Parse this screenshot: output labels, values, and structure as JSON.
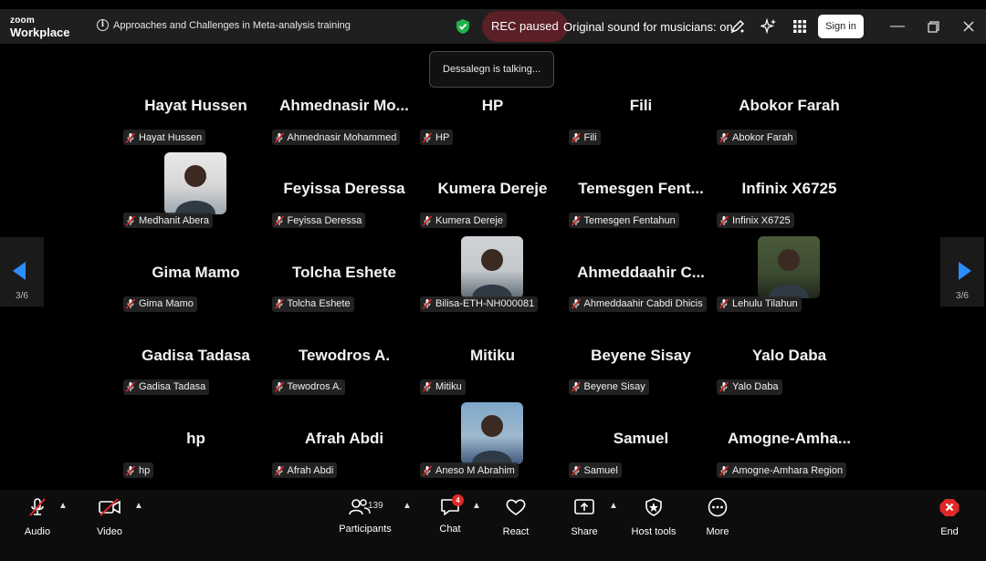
{
  "app": {
    "brand_top": "zoom",
    "brand_bottom": "Workplace"
  },
  "meeting": {
    "title": "Approaches and Challenges in Meta-analysis training"
  },
  "status": {
    "rec": "REC paused",
    "original_sound": "Original sound for musicians: on",
    "sign_in": "Sign in",
    "talking": "Dessalegn is talking..."
  },
  "nav": {
    "left_page": "3/6",
    "right_page": "3/6"
  },
  "participants": [
    {
      "big": "Hayat Hussen",
      "label": "Hayat Hussen",
      "photo": false
    },
    {
      "big": "Ahmednasir  Mo...",
      "label": "Ahmednasir Mohammed",
      "photo": false
    },
    {
      "big": "HP",
      "label": "HP",
      "photo": false
    },
    {
      "big": "Fili",
      "label": "Fili",
      "photo": false
    },
    {
      "big": "Abokor Farah",
      "label": "Abokor Farah",
      "photo": false
    },
    {
      "big": "",
      "label": "Medhanit Abera",
      "photo": true
    },
    {
      "big": "Feyissa Deressa",
      "label": "Feyissa Deressa",
      "photo": false
    },
    {
      "big": "Kumera Dereje",
      "label": "Kumera Dereje",
      "photo": false
    },
    {
      "big": "Temesgen  Fent...",
      "label": "Temesgen Fentahun",
      "photo": false
    },
    {
      "big": "Infinix X6725",
      "label": "Infinix X6725",
      "photo": false
    },
    {
      "big": "Gima Mamo",
      "label": "Gima Mamo",
      "photo": false
    },
    {
      "big": "Tolcha Eshete",
      "label": "Tolcha Eshete",
      "photo": false
    },
    {
      "big": "",
      "label": "Bilisa-ETH-NH000081",
      "photo": true
    },
    {
      "big": "Ahmeddaahir  C...",
      "label": "Ahmeddaahir Cabdi Dhicis",
      "photo": false
    },
    {
      "big": "",
      "label": "Lehulu Tilahun",
      "photo": true
    },
    {
      "big": "Gadisa Tadasa",
      "label": "Gadisa Tadasa",
      "photo": false
    },
    {
      "big": "Tewodros A.",
      "label": "Tewodros A.",
      "photo": false
    },
    {
      "big": "Mitiku",
      "label": "Mitiku",
      "photo": false
    },
    {
      "big": "Beyene Sisay",
      "label": "Beyene Sisay",
      "photo": false
    },
    {
      "big": "Yalo Daba",
      "label": "Yalo Daba",
      "photo": false
    },
    {
      "big": "hp",
      "label": "hp",
      "photo": false
    },
    {
      "big": "Afrah Abdi",
      "label": "Afrah Abdi",
      "photo": false
    },
    {
      "big": "",
      "label": "Aneso M Abrahim",
      "photo": true
    },
    {
      "big": "Samuel",
      "label": "Samuel",
      "photo": false
    },
    {
      "big": "Amogne-Amha...",
      "label": "Amogne-Amhara Region",
      "photo": false
    }
  ],
  "toolbar": {
    "audio": "Audio",
    "video": "Video",
    "participants": "Participants",
    "participants_count": "139",
    "chat": "Chat",
    "chat_badge": "4",
    "react": "React",
    "share": "Share",
    "host_tools": "Host tools",
    "more": "More",
    "end": "End"
  },
  "colors": {
    "accent": "#2d8cff",
    "end": "#e02828",
    "rec_bg": "#5b1f26"
  }
}
